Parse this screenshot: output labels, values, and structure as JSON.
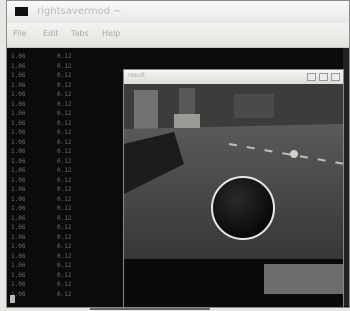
{
  "window": {
    "title": "rightsavermod ~"
  },
  "menu": {
    "file": "File",
    "edit": "Edit",
    "tabs": "Tabs",
    "help": "Help"
  },
  "terminal": {
    "col1": [
      "1.06",
      "1.06",
      "1.06",
      "1.06",
      "1.06",
      "1.06",
      "1.06",
      "1.06",
      "1.06",
      "1.06",
      "1.06",
      "1.06",
      "1.06",
      "1.06",
      "1.06",
      "1.06",
      "1.06",
      "1.06",
      "1.06",
      "1.06",
      "1.06",
      "1.06",
      "1.06",
      "1.06",
      "1.06",
      "1.06"
    ],
    "col2": [
      "0.12",
      "0.12",
      "0.12",
      "0.12",
      "0.12",
      "0.12",
      "0.12",
      "0.12",
      "0.12",
      "0.12",
      "0.12",
      "0.12",
      "0.12",
      "0.12",
      "0.12",
      "0.12",
      "0.12",
      "0.12",
      "0.12",
      "0.12",
      "0.12",
      "0.12",
      "0.12",
      "0.12",
      "0.12",
      "0.12"
    ]
  },
  "viewer": {
    "title": "result"
  },
  "icons": {
    "app": "terminal-icon"
  }
}
